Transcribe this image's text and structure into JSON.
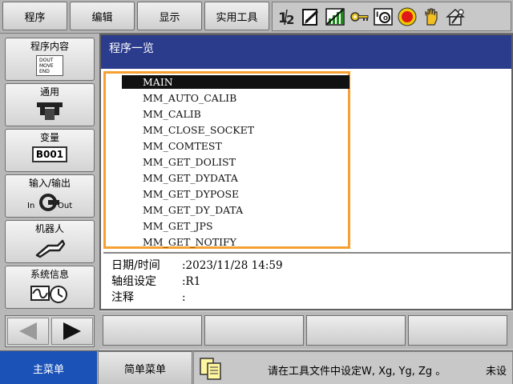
{
  "top_menu": {
    "items": [
      {
        "label": "程序"
      },
      {
        "label": "编辑"
      },
      {
        "label": "显示"
      },
      {
        "label": "实用工具"
      }
    ]
  },
  "status_icons": [
    "axis-group-12-icon",
    "edit-mode-icon",
    "play-mode-icon",
    "key-icon",
    "io-icon",
    "stop-icon",
    "hand-icon",
    "home-icon"
  ],
  "sidebar": {
    "items": [
      {
        "label": "程序内容",
        "icon": "document-icon",
        "icon_lines": [
          "DOUT",
          "MOVE",
          "END"
        ]
      },
      {
        "label": "通用",
        "icon": "tool-icon"
      },
      {
        "label": "变量",
        "icon": "variable-icon",
        "icon_text": "B001"
      },
      {
        "label": "输入/输出",
        "icon": "io-icon",
        "icon_in": "In",
        "icon_out": "Out"
      },
      {
        "label": "机器人",
        "icon": "robot-arm-icon"
      },
      {
        "label": "系统信息",
        "icon": "system-info-icon"
      }
    ]
  },
  "window": {
    "title": "程序一览",
    "programs": [
      "MAIN",
      "MM_AUTO_CALIB",
      "MM_CALIB",
      "MM_CLOSE_SOCKET",
      "MM_COMTEST",
      "MM_GET_DOLIST",
      "MM_GET_DYDATA",
      "MM_GET_DYPOSE",
      "MM_GET_DY_DATA",
      "MM_GET_JPS",
      "MM_GET_NOTIFY"
    ],
    "selected_index": 0,
    "info": {
      "date_label": "日期/时间",
      "date_value": ":2023/11/28 14:59",
      "axis_label": "轴组设定",
      "axis_value": ":R1",
      "comment_label": "注释",
      "comment_value": ":"
    }
  },
  "bottom": {
    "main_menu": "主菜单",
    "simple_menu": "简单菜单",
    "message": "请在工具文件中设定W, Xg, Yg, Zg 。",
    "message_tail": "未设"
  },
  "colors": {
    "title_bar": "#2c3c8c",
    "main_menu": "#1a52b8",
    "list_border": "#f5a030",
    "selection": "#111111"
  }
}
